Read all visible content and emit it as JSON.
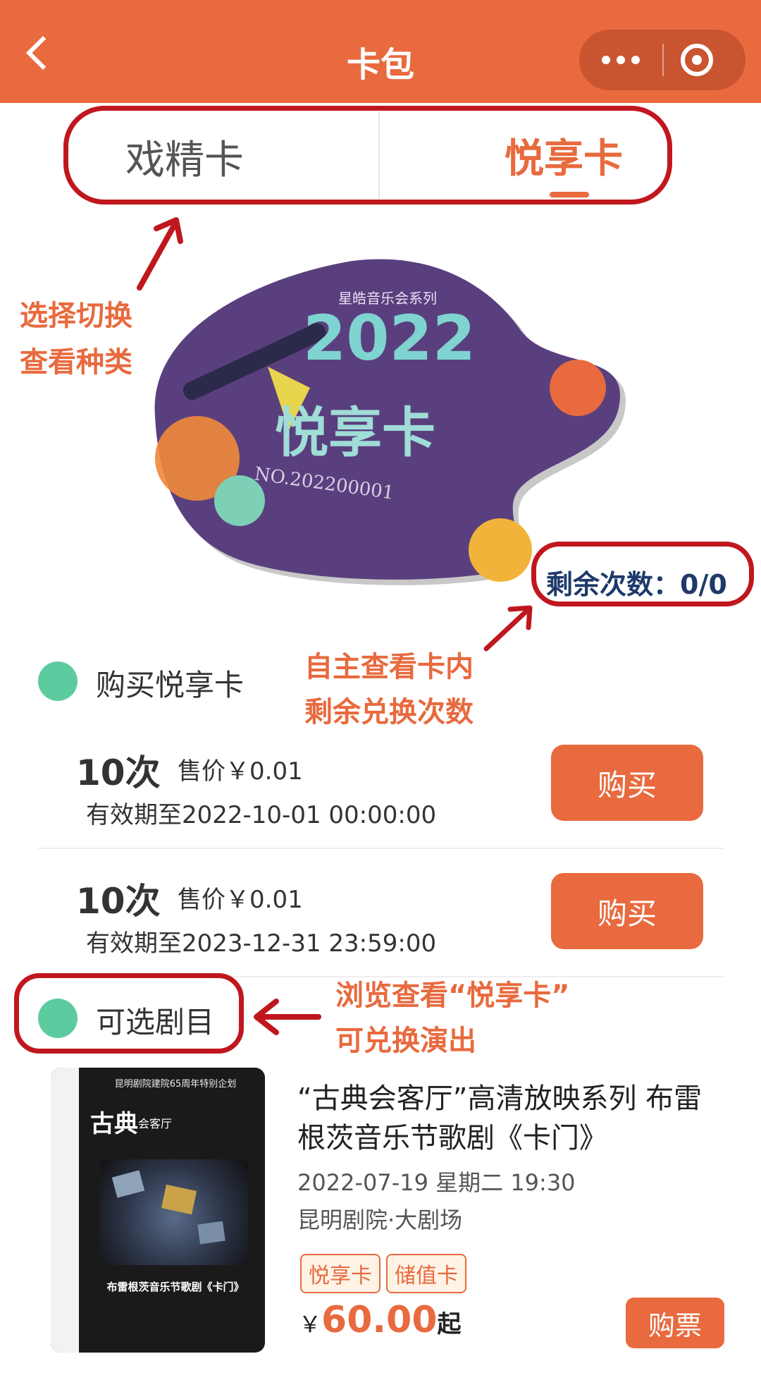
{
  "header": {
    "title": "卡包"
  },
  "tabs": [
    {
      "label": "戏精卡"
    },
    {
      "label": "悦享卡"
    }
  ],
  "annotations": {
    "tabs_line1": "选择切换",
    "tabs_line2": "查看种类",
    "remain_line1": "自主查看卡内",
    "remain_line2": "剩余兑换次数",
    "shows_line1": "浏览查看“悦享卡”",
    "shows_line2": "可兑换演出"
  },
  "card": {
    "series": "星皓音乐会系列",
    "year": "2022",
    "name": "悦享卡",
    "number": "NO.202200001",
    "remaining_label": "剩余次数：0/0"
  },
  "purchase": {
    "title": "购买悦享卡",
    "options": [
      {
        "count": "10次",
        "price": "售价￥0.01",
        "validity": "有效期至2022-10-01 00:00:00",
        "button": "购买"
      },
      {
        "count": "10次",
        "price": "售价￥0.01",
        "validity": "有效期至2023-12-31 23:59:00",
        "button": "购买"
      }
    ]
  },
  "shows": {
    "title": "可选剧目",
    "items": [
      {
        "title": "“古典会客厅”高清放映系列 布雷根茨音乐节歌剧《卡门》",
        "datetime": "2022-07-19 星期二 19:30",
        "venue": "昆明剧院·大剧场",
        "tags": [
          "悦享卡",
          "储值卡"
        ],
        "price_symbol": "￥",
        "price": "60.00",
        "price_suffix": "起",
        "button": "购票",
        "poster": {
          "top": "昆明剧院建院65周年特别企划",
          "brand": "古典",
          "brand_sub": "会客厅",
          "caption": "布雷根茨音乐节歌剧《卡门》"
        }
      }
    ]
  },
  "colors": {
    "accent": "#E86A3E",
    "annotation_red": "#C0171E",
    "green": "#5DCBA0",
    "card_purple": "#5A3F7E"
  }
}
